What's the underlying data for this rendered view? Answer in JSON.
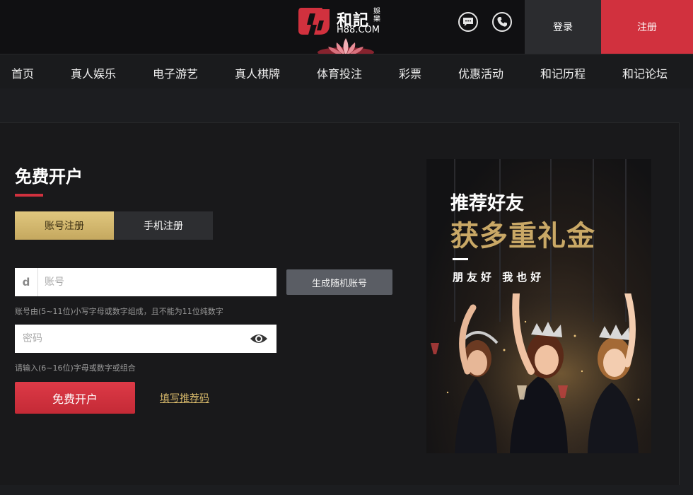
{
  "header": {
    "logo_name": "和記",
    "logo_tag": "娛樂",
    "logo_site": "H88.COM",
    "chat_icon": "chat-bubble-icon",
    "phone_icon": "phone-icon",
    "login_label": "登录",
    "register_label": "注册",
    "colors": {
      "register_bg": "#d1313e",
      "login_bg": "#2b2c2f",
      "topbar_bg": "#101012"
    }
  },
  "nav": {
    "items": [
      "首页",
      "真人娱乐",
      "电子游艺",
      "真人棋牌",
      "体育投注",
      "彩票",
      "优惠活动",
      "和记历程",
      "和记论坛"
    ]
  },
  "form": {
    "title": "免费开户",
    "tabs": [
      "账号注册",
      "手机注册"
    ],
    "username_prefix": "d",
    "username_placeholder": "账号",
    "generate_label": "生成随机账号",
    "username_hint": "账号由(5~11位)小写字母或数字组成，且不能为11位纯数字",
    "password_placeholder": "密码",
    "password_hint": "请输入(6~16位)字母或数字或组合",
    "submit_label": "免费开户",
    "referral_link": "填写推荐码",
    "colors": {
      "accent": "#d1313e",
      "gold": "#c9a866"
    }
  },
  "promo": {
    "line1": "推荐好友",
    "line2": "获多重礼金",
    "line3": "朋友好 我也好"
  }
}
